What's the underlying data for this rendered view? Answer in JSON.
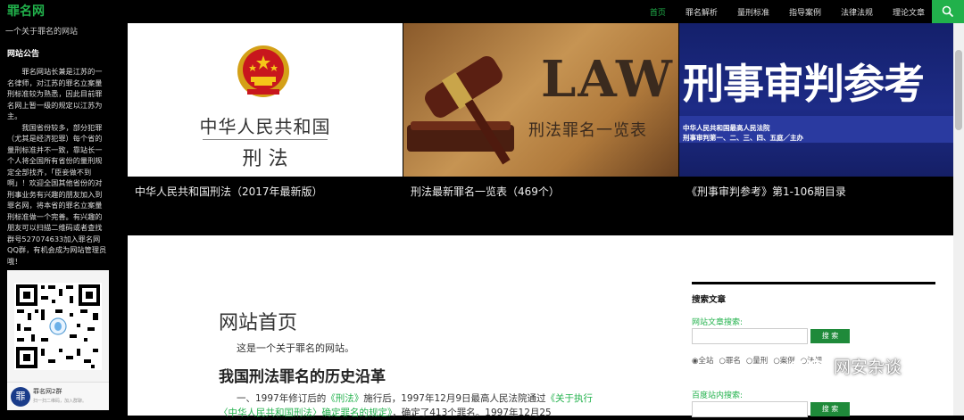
{
  "site": {
    "logo": "罪名网",
    "tagline": "一个关于罪名的网站"
  },
  "nav": {
    "items": [
      "首页",
      "罪名解析",
      "量刑标准",
      "指导案例",
      "法律法规",
      "理论文章"
    ],
    "active_index": 0,
    "accent": "#21b14b"
  },
  "sidebar": {
    "notice_title": "网站公告",
    "notice_paragraphs": [
      "罪名网站长兼是江苏的一名律师，对江苏的罪名立案量刑标准较为熟悉，因此目前罪名网上暂一级的规定以江苏为主。",
      "我国省份较多，部分犯罪（尤其是经济犯罪）每个省的量刑标准并不一致，靠站长一个人将全国所有省份的量刑规定全部找齐，「臣妾做不到啊」！欢迎全国其他省份的对刑事业务有兴趣的朋友加入到罪名网，将本省的罪名立案量刑标准做一个完善。有兴趣的朋友可以扫描二维码或者查找群号527074633加入罪名网QQ群，有机会成为网站管理员哦！"
    ],
    "qr": {
      "group_name": "罪名网2群",
      "hint": "扫一扫二维码，加入群聊。",
      "avatar_text": "罪"
    }
  },
  "featured": [
    {
      "caption": "中华人民共和国刑法（2017年最新版）",
      "title_line1": "中华人民共和国",
      "title_line2": "刑 法"
    },
    {
      "caption": "刑法最新罪名一览表（469个）",
      "word": "LAW",
      "subtitle": "刑法罪名一览表"
    },
    {
      "caption": "《刑事审判参考》第1-106期目录",
      "big_title": "刑事审判参考",
      "pub_line1": "中华人民共和国最高人民法院",
      "pub_line2": "刑事审判第一、二、三、四、五庭／主办"
    }
  ],
  "content": {
    "page_title": "网站首页",
    "intro": "这是一个关于罪名的网站。",
    "article_title": "我国刑法罪名的历史沿革",
    "text_1": "一、1997年修订后的",
    "link_1": "《刑法》",
    "text_2": "施行后，1997年12月9日最高人民法院通过",
    "link_2": "《关于执行〈中华人民共和国刑法〉确定罪名的规定》",
    "text_3": "，确定了413个罪名。1997年12月25"
  },
  "widget": {
    "title": "搜索文章",
    "label_site": "网站文章搜索:",
    "btn_search": "搜 索",
    "radios": [
      "全站",
      "罪名",
      "量刑",
      "案例",
      "法规"
    ],
    "label_baidu": "百度站内搜索:",
    "btn_search2": "搜 索"
  },
  "watermark": {
    "text": "网安杂谈"
  }
}
